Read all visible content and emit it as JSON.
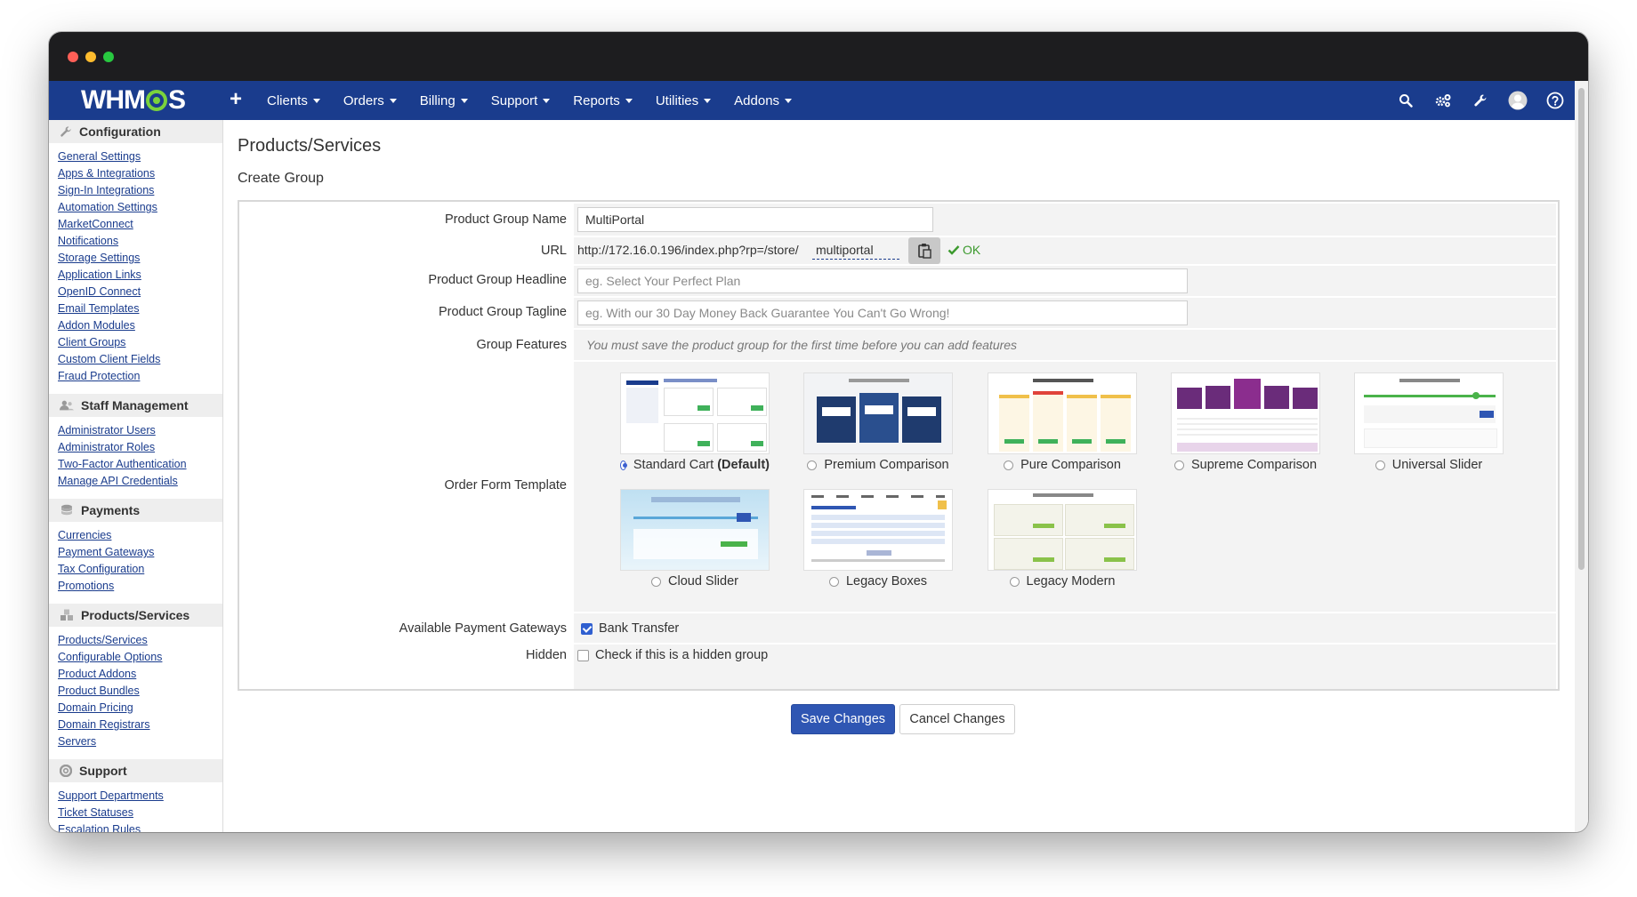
{
  "nav": {
    "logo": "WHMCS",
    "add_icon": "plus-icon",
    "menu": [
      {
        "label": "Clients"
      },
      {
        "label": "Orders"
      },
      {
        "label": "Billing"
      },
      {
        "label": "Support"
      },
      {
        "label": "Reports"
      },
      {
        "label": "Utilities"
      },
      {
        "label": "Addons"
      }
    ],
    "icons": [
      "search-icon",
      "cogs-icon",
      "wrench-icon",
      "avatar-icon",
      "help-icon"
    ],
    "color": "#1a3c8d"
  },
  "sidebar": {
    "configuration": {
      "title": "Configuration",
      "icon": "wrench-icon",
      "links": [
        "General Settings",
        "Apps & Integrations",
        "Sign-In Integrations",
        "Automation Settings",
        "MarketConnect",
        "Notifications",
        "Storage Settings",
        "Application Links",
        "OpenID Connect",
        "Email Templates",
        "Addon Modules",
        "Client Groups",
        "Custom Client Fields",
        "Fraud Protection"
      ]
    },
    "staff": {
      "title": "Staff Management",
      "icon": "users-icon",
      "links": [
        "Administrator Users",
        "Administrator Roles",
        "Two-Factor Authentication",
        "Manage API Credentials"
      ]
    },
    "payments": {
      "title": "Payments",
      "icon": "money-icon",
      "links": [
        "Currencies",
        "Payment Gateways",
        "Tax Configuration",
        "Promotions"
      ]
    },
    "products": {
      "title": "Products/Services",
      "icon": "cubes-icon",
      "links": [
        "Products/Services",
        "Configurable Options",
        "Product Addons",
        "Product Bundles",
        "Domain Pricing",
        "Domain Registrars",
        "Servers"
      ]
    },
    "support": {
      "title": "Support",
      "icon": "support-icon",
      "links": [
        "Support Departments",
        "Ticket Statuses",
        "Escalation Rules"
      ]
    }
  },
  "page": {
    "title": "Products/Services",
    "subtitle": "Create Group"
  },
  "form": {
    "group_name": {
      "label": "Product Group Name",
      "value": "MultiPortal"
    },
    "url": {
      "label": "URL",
      "prefix": "http://172.16.0.196/index.php?rp=/store/",
      "slug": "multiportal",
      "status": "OK",
      "copy_icon": "clipboard-icon"
    },
    "headline": {
      "label": "Product Group Headline",
      "placeholder": "eg. Select Your Perfect Plan"
    },
    "tagline": {
      "label": "Product Group Tagline",
      "placeholder": "eg. With our 30 Day Money Back Guarantee You Can't Go Wrong!"
    },
    "features": {
      "label": "Group Features",
      "note": "You must save the product group for the first time before you can add features"
    },
    "order_form": {
      "label": "Order Form Template",
      "templates": [
        {
          "name": "Standard Cart",
          "suffix": "(Default)",
          "selected": true
        },
        {
          "name": "Premium Comparison",
          "selected": false
        },
        {
          "name": "Pure Comparison",
          "selected": false
        },
        {
          "name": "Supreme Comparison",
          "selected": false
        },
        {
          "name": "Universal Slider",
          "selected": false
        },
        {
          "name": "Cloud Slider",
          "selected": false
        },
        {
          "name": "Legacy Boxes",
          "selected": false
        },
        {
          "name": "Legacy Modern",
          "selected": false
        }
      ]
    },
    "gateways": {
      "label": "Available Payment Gateways",
      "option": "Bank Transfer",
      "checked": true
    },
    "hidden": {
      "label": "Hidden",
      "option": "Check if this is a hidden group",
      "checked": false
    }
  },
  "actions": {
    "save": "Save Changes",
    "cancel": "Cancel Changes",
    "primary_color": "#2f56b3"
  }
}
